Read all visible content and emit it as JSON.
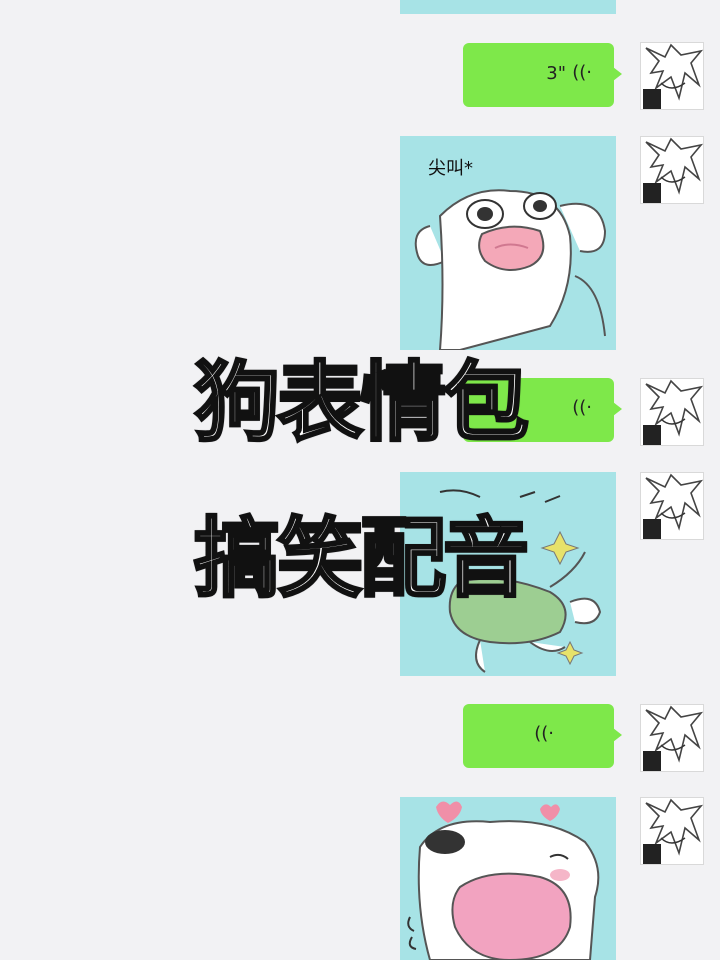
{
  "messages": [
    {
      "kind": "sticker_top_fragment"
    },
    {
      "kind": "voice",
      "duration": "3\"",
      "icon": "voice-wave-icon"
    },
    {
      "kind": "sticker",
      "caption": "尖叫*",
      "description": "screaming-dog-sticker"
    },
    {
      "kind": "voice",
      "duration": "",
      "icon": "voice-wave-icon"
    },
    {
      "kind": "sticker",
      "caption": "",
      "description": "flying-dog-sticker"
    },
    {
      "kind": "voice",
      "duration": "",
      "icon": "voice-wave-icon"
    },
    {
      "kind": "sticker",
      "caption": "",
      "description": "licking-dog-sticker"
    }
  ],
  "overlay": {
    "line1": "狗表情包",
    "line2": "搞笑配音"
  },
  "colors": {
    "background": "#f2f2f4",
    "bubble_green": "#7ee84a",
    "sticker_bg": "#a7e3e6"
  }
}
